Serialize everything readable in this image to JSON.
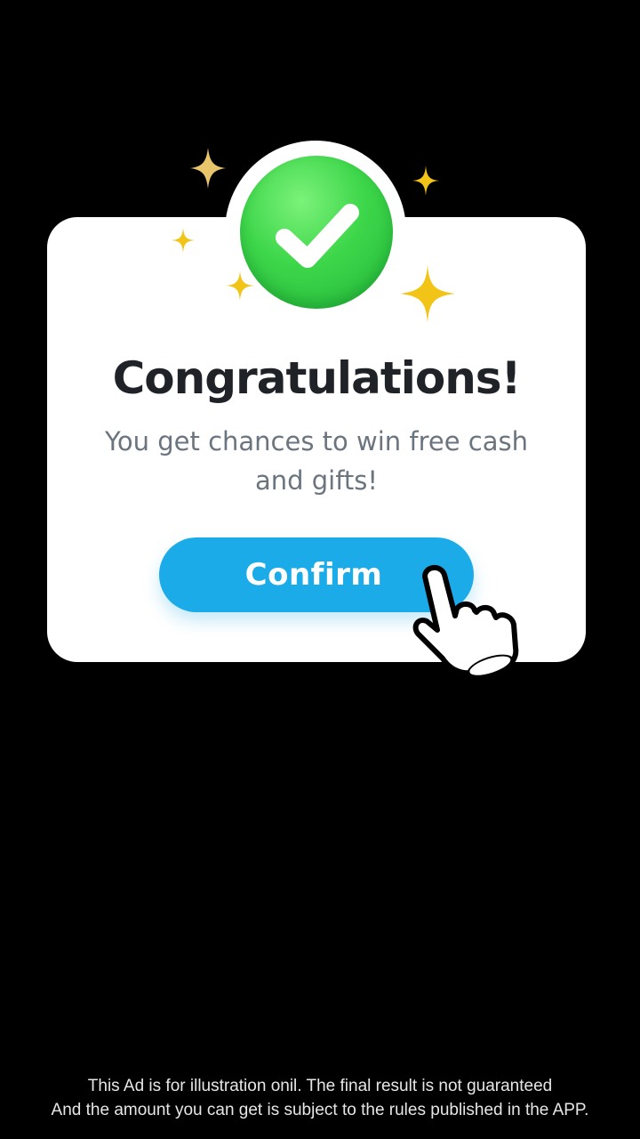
{
  "dialog": {
    "title": "Congratulations!",
    "subtitle": "You get chances to win free cash and gifts!",
    "confirm_label": "Confirm",
    "badge_icon": "checkmark-icon",
    "pointer_icon": "pointing-hand-icon"
  },
  "disclaimer": {
    "line1": "This Ad is for illustration onil. The final result is not guaranteed",
    "line2": "And the amount you can get is subject to the rules published in the APP."
  },
  "colors": {
    "background": "#000000",
    "card": "#ffffff",
    "badge_green": "#3dd64a",
    "button_blue": "#1aabe8",
    "sparkle_gold": "#f2c418",
    "title_text": "#1f2226",
    "subtitle_text": "#6b7580"
  }
}
